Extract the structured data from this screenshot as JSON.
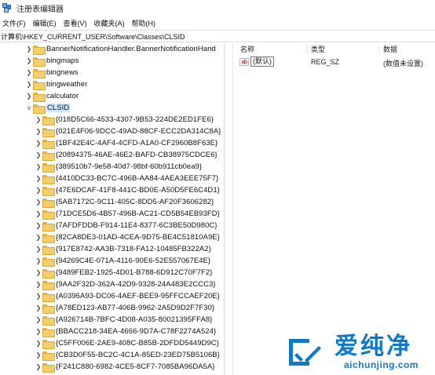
{
  "window": {
    "title": "注册表编辑器",
    "icon": "registry-editor-icon"
  },
  "menu": [
    "文件(F)",
    "编辑(E)",
    "查看(V)",
    "收藏夹(A)",
    "帮助(H)"
  ],
  "address_bar": {
    "path": "计算机\\HKEY_CURRENT_USER\\Software\\Classes\\CLSID"
  },
  "tree": {
    "nodes": [
      {
        "label": "BannerNotificationHandler.BannerNotificationHand",
        "expander": "collapsed",
        "selected": false
      },
      {
        "label": "bingmaps",
        "expander": "collapsed",
        "selected": false
      },
      {
        "label": "bingnews",
        "expander": "collapsed",
        "selected": false
      },
      {
        "label": "bingweather",
        "expander": "collapsed",
        "selected": false
      },
      {
        "label": "calculator",
        "expander": "collapsed",
        "selected": false
      },
      {
        "label": "CLSID",
        "expander": "expanded",
        "selected": true
      }
    ],
    "clsid_children": [
      "{018D5C66-4533-4307-9B53-224DE2ED1FE6}",
      "{021E4F06-9DCC-49AD-88CF-ECC2DA314C8A}",
      "{1BF42E4C-4AF4-4CFD-A1A0-CF2960B8F63E}",
      "{20894375-46AE-46E2-BAFD-CB38975CDCE6}",
      "{389510b7-9e58-40d7-98bf-60b911cb0ea9}",
      "{4410DC33-BC7C-496B-AA84-4AEA3EEE75F7}",
      "{47E6DCAF-41F8-441C-BD0E-A50D5FE6C4D1}",
      "{5AB7172C-9C11-405C-8DD5-AF20F3606282}",
      "{71DCE5D6-4B57-496B-AC21-CD5B54EB93FD}",
      "{7AFDFDDB-F914-11E4-8377-6C3BE50D980C}",
      "{82CA8DE3-01AD-4CEA-9D75-BE4C51810A9E}",
      "{917E8742-AA3B-7318-FA12-10485FB322A2}",
      "{94269C4E-071A-4116-90E6-52E557067E4E}",
      "{9489FEB2-1925-4D01-B788-6D912C70F7F2}",
      "{9AA2F32D-362A-42D9-9328-24A483E2CCC3}",
      "{A0396A93-DC06-4AEF-BEE9-95FFCCAEF20E}",
      "{A78ED123-AB77-406B-9962-2A5D9D2F7F30}",
      "{A926714B-7BFC-4D08-A035-80021395FFA8}",
      "{BBACC218-34EA-4666-9D7A-C78F2274A524}",
      "{C5FF006E-2AE9-408C-B85B-2DFDD5449D9C}",
      "{CB3D0F55-BC2C-4C1A-85ED-23ED75B5106B}",
      "{F241C880-6982-4CE5-8CF7-7085BA96DA5A}"
    ]
  },
  "list": {
    "headers": {
      "name": "名称",
      "type": "类型",
      "data": "数据"
    },
    "rows": [
      {
        "icon": "string-value-icon",
        "icon_text": "ab",
        "name": "(默认)",
        "type": "REG_SZ",
        "data": "(数值未设置)"
      }
    ]
  },
  "watermark": {
    "title": "爱纯净",
    "url": "aichunjing.com",
    "color": "#0f78c8"
  }
}
